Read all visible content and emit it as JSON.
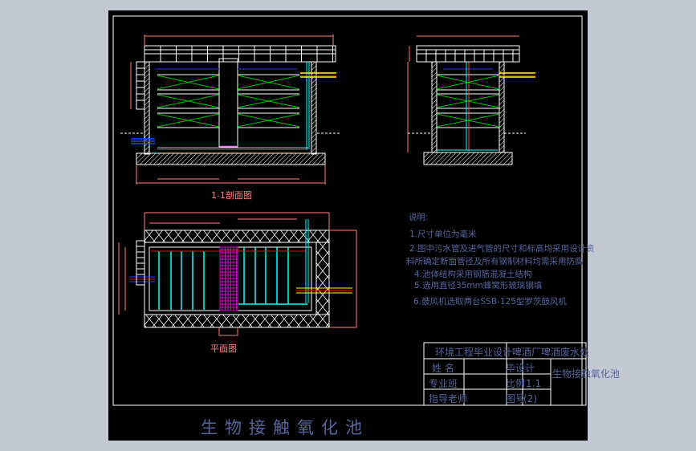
{
  "drawing": {
    "section_label": "1-1剖面图",
    "plan_label": "平面图",
    "main_title": "生物接触氧化池"
  },
  "notes": {
    "heading": "说明:",
    "items": [
      "1.尺寸单位为毫米",
      "2.图中污水管及进气管的尺寸和标高均采用设计资",
      "料所确定断面管径及所有钢制材料均需采用防腐",
      "4.池体结构采用钢筋混凝土结构",
      "5.选用直径35mm蜂窝形玻璃钢填",
      "6.鼓风机选取两台SSB-125型罗茨鼓风机"
    ]
  },
  "title_block": {
    "header": "环境工程毕业设计啤酒厂啤酒废水处",
    "name_label": "姓 名",
    "major_label": "专业班",
    "advisor_label": "指导老师",
    "design_label": "毕设计",
    "scale_label": "比例",
    "scale_value": "1.1",
    "drawing_no_label": "图号",
    "drawing_no_value": "(2)",
    "drawing_name": "生物接触氧化池"
  },
  "colors": {
    "background": "#c4c8d2",
    "sheet": "#000000",
    "outline": "#ffffff",
    "dimension": "#ff8080",
    "media": "#00c000",
    "water_pipe": "#00ffff",
    "air_pipe": "#ff0000",
    "inlet_pipe": "#ffff00",
    "grid": "#cc00cc",
    "text": "#56649f"
  }
}
